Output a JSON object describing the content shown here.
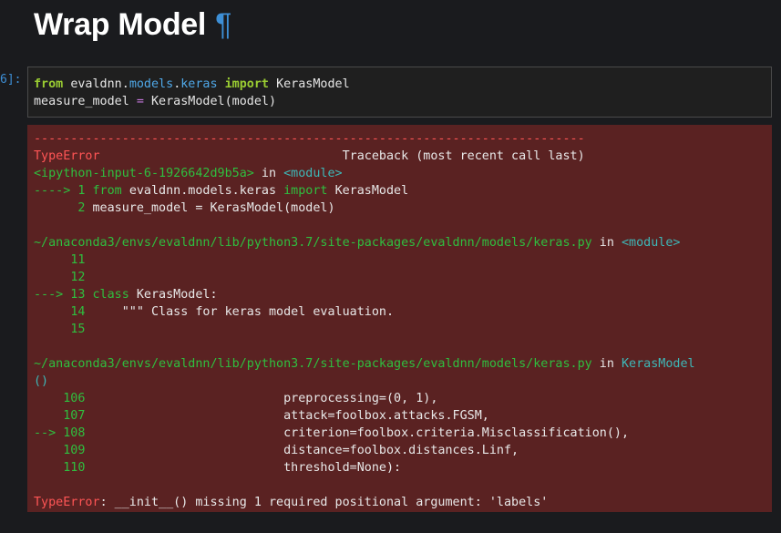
{
  "heading": {
    "title": "Wrap Model",
    "pilcrow": "¶"
  },
  "prompt": "6]:",
  "code": {
    "line1": {
      "kw1": "from",
      "mod_a": "evaldnn",
      "dot1": ".",
      "mod_b": "models",
      "dot2": ".",
      "mod_c": "keras",
      "kw2": "import",
      "name": "KerasModel"
    },
    "line2": {
      "var": "measure_model",
      "op": "=",
      "call": "KerasModel(model)"
    }
  },
  "traceback": {
    "dashes": "---------------------------------------------------------------------------",
    "err_name": "TypeError",
    "header_right": "Traceback (most recent call last)",
    "input_ref": "<ipython-input-6-1926642d9b5a>",
    "in_word": "in",
    "module1": "<module>",
    "f1_arrow": "----> 1",
    "f1_from": "from",
    "f1_rest": "evaldnn.models.keras",
    "f1_import": "import",
    "f1_name": "KerasModel",
    "f1_line2_no": "2",
    "f1_line2": "measure_model = KerasModel(model)",
    "path1": "~/anaconda3/envs/evaldnn/lib/python3.7/site-packages/evaldnn/models/keras.py",
    "in_word2": "in",
    "module2": "<module>",
    "f2_l11": "11",
    "f2_l12": "12",
    "f2_arrow": "---> 13",
    "f2_class": "class",
    "f2_classname": "KerasModel",
    "f2_colon": ":",
    "f2_l14": "14",
    "f2_doc": "\"\"\" Class for keras model evaluation.",
    "f2_l15": "15",
    "path2": "~/anaconda3/envs/evaldnn/lib/python3.7/site-packages/evaldnn/models/keras.py",
    "in_word3": "in",
    "func3": "KerasModel",
    "func3_paren": "()",
    "f3": [
      {
        "no": "106",
        "arrow": "",
        "text": "preprocessing=(0, 1),"
      },
      {
        "no": "107",
        "arrow": "",
        "text": "attack=foolbox.attacks.FGSM,"
      },
      {
        "no": "108",
        "arrow": "-->",
        "text": "criterion=foolbox.criteria.Misclassification(),"
      },
      {
        "no": "109",
        "arrow": "",
        "text": "distance=foolbox.distances.Linf,"
      },
      {
        "no": "110",
        "arrow": "",
        "text": "threshold=None):"
      }
    ],
    "final_err": "TypeError",
    "final_msg": ": __init__() missing 1 required positional argument: 'labels'"
  },
  "colors": {
    "background": "#1a1b1e",
    "error_bg": "#5a2222",
    "accent": "#3d8fd6"
  }
}
